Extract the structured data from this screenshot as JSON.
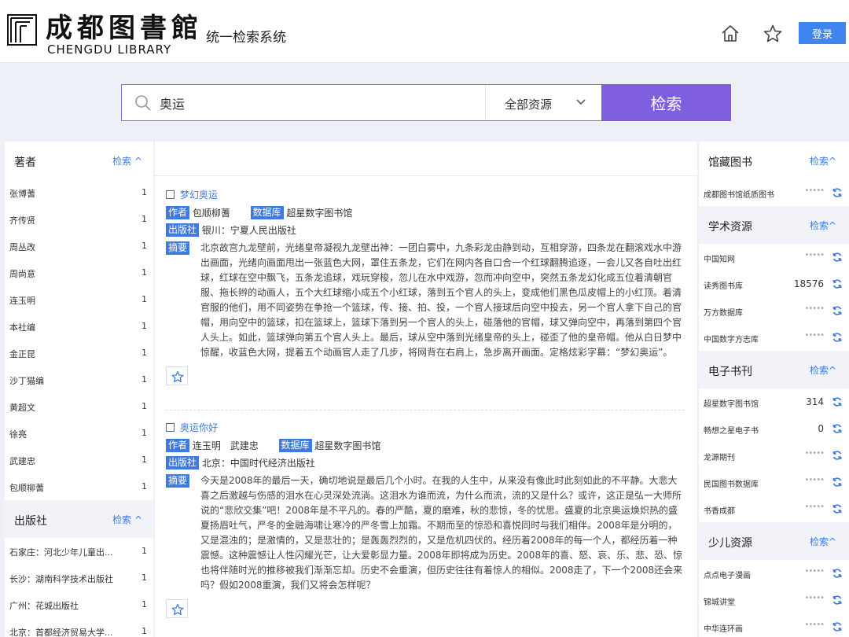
{
  "header": {
    "logo_cn": "成都图書館",
    "logo_en": "CHENGDU LIBRARY",
    "system_title": "统一检索系统",
    "login_label": "登录"
  },
  "search": {
    "query": "奥运",
    "scope_label": "全部资源",
    "button_label": "检索"
  },
  "left_facets": [
    {
      "title": "著者",
      "action": "检索 ^",
      "items": [
        {
          "name": "张博蓍",
          "count": "1"
        },
        {
          "name": "齐传贤",
          "count": "1"
        },
        {
          "name": "周丛改",
          "count": "1"
        },
        {
          "name": "周尚意",
          "count": "1"
        },
        {
          "name": "连玉明",
          "count": "1"
        },
        {
          "name": "本社编",
          "count": "1"
        },
        {
          "name": "金正昆",
          "count": "1"
        },
        {
          "name": "沙丁猫编",
          "count": "1"
        },
        {
          "name": "黄超文",
          "count": "1"
        },
        {
          "name": "徐亮",
          "count": "1"
        },
        {
          "name": "武建忠",
          "count": "1"
        },
        {
          "name": "包顺柳蓍",
          "count": "1"
        }
      ]
    },
    {
      "title": "出版社",
      "action": "检索 ^",
      "items": [
        {
          "name": "石家庄：河北少年儿童出...",
          "count": "1"
        },
        {
          "name": "长沙：湖南科学技术出版社",
          "count": "1"
        },
        {
          "name": "广州：花城出版社",
          "count": "1"
        },
        {
          "name": "北京：首都经济贸易大学...",
          "count": "1"
        }
      ]
    }
  ],
  "labels": {
    "author": "作者",
    "database": "数据库",
    "publisher": "出版社",
    "abstract": "摘要"
  },
  "results": [
    {
      "title": "梦幻奥运",
      "authors": "包顺柳蓍",
      "database": "超星数字图书馆",
      "publisher": "银川：宁夏人民出版社",
      "abstract": "北京故宫九龙壁前，光绪皇帝凝视九龙壁出神：一团白雾中，九条彩龙由静到动，互相穿游，四条龙在翻滚戏水中游出画面，光绪向画面甩出一张蓝色大网，罩住五条龙，它们在网内各自口合一个红球翻腾追逐，一会儿又各自吐出红球，红球在空中飘飞，五条龙追球，戏玩穿梭，忽儿在水中戏游，忽而冲向空中，突然五条龙幻化成五位着清朝官服、拖长辫的动画人，五个大红球缩小成五个小红球，落到五个官人的头上，变成他们黑色瓜皮帽上的小红顶。着清官服的他们，用不同姿势在争抢一个篮球，传、接、拍、投，一个官人接球后向空中投去，另一个官人拿下自己的官帽，用向空中的篮球，扣在篮球上，篮球下落到另一个官人的头上，碰落他的官帽，球又弹向空中，再落到第四个官人头上。如此，篮球弹向第五个官人头上。最后，球从空中落到光绪皇帝的头上，碰歪了他的皇帝帽。他从白日梦中惊醒，收蓝色大网，提着五个动画官人走了几步，将网背在右肩上，急步离开画面。定格炫彩字幕：“梦幻奥运”。"
    },
    {
      "title": "奥运你好",
      "authors": "连玉明　武建忠",
      "database": "超星数字图书馆",
      "publisher": "北京：中国时代经济出版社",
      "abstract": "今天是2008年的最后一天，确切地说是最后几个小时。在我的人生中，从来没有像此时此刻如此的不平静。大悲大喜之后激越与伤感的泪水在心灵深处流淌。这泪水为谁而流，为什么而流，流的又是什么？或许，这正是弘一大师所说的“悲欣交集”吧！2008年是不平凡的。春的严酷，夏的磨难，秋的悲惊，冬的忧思。盛夏的北京奥运焕炽热的盛夏扬眉吐气，严冬的金融海啸让寒冷的严冬雪上加霜。不期而至的惊恐和喜悦同时与我们相伴。2008年是分明的，又是混浊的；是激情的，又是悲壮的；是轰轰烈烈的，又是危机四伏的。经历着2008年的每一个人，都经历着一种震憾。这种震憾让人性闪耀光芒，让大爱彰显力量。2008年即将成为历史。2008年的喜、怒、哀、乐、悲、恐、惊也将伴随时光的推移被我们渐渐忘却。历史不会重演，但历史往往有着惊人的相似。2008走了，下一个2008还会来吗？假如2008重演，我们又将会怎样呢？"
    }
  ],
  "right_groups": [
    {
      "title": "馆藏图书",
      "action": "检索^",
      "items": [
        {
          "name": "成都图书馆纸质图书",
          "count": ""
        }
      ]
    },
    {
      "title": "学术资源",
      "action": "检索^",
      "items": [
        {
          "name": "中国知网",
          "count": ""
        },
        {
          "name": "读秀图书库",
          "count": "18576"
        },
        {
          "name": "万方数据库",
          "count": ""
        },
        {
          "name": "中国数字方志库",
          "count": ""
        }
      ]
    },
    {
      "title": "电子书刊",
      "action": "检索^",
      "items": [
        {
          "name": "超星数字图书馆",
          "count": "314"
        },
        {
          "name": "畅想之星电子书",
          "count": "0"
        },
        {
          "name": "龙源期刊",
          "count": ""
        },
        {
          "name": "民国图书数据库",
          "count": ""
        },
        {
          "name": "书香成都",
          "count": ""
        }
      ]
    },
    {
      "title": "少儿资源",
      "action": "检索^",
      "items": [
        {
          "name": "点点电子漫画",
          "count": ""
        },
        {
          "name": "锦城讲堂",
          "count": ""
        },
        {
          "name": "中华连环画",
          "count": ""
        }
      ]
    }
  ],
  "colors": {
    "accent_blue": "#3f7ae0",
    "search_purple": "#7f5fe0",
    "login_blue": "#3f84ef"
  },
  "icons": [
    "logo-mark-icon",
    "home-icon",
    "star-icon",
    "search-icon",
    "chevron-down-icon",
    "refresh-icon",
    "favorite-star-icon"
  ]
}
